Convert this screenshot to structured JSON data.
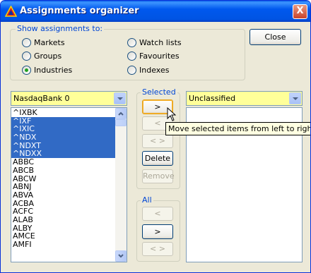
{
  "window": {
    "title": "Assignments organizer",
    "close_glyph": "X",
    "icon": "red-triangle-icon"
  },
  "show_group": {
    "legend": "Show assignments to:",
    "options": [
      {
        "label": "Markets",
        "selected": false
      },
      {
        "label": "Groups",
        "selected": false
      },
      {
        "label": "Industries",
        "selected": true
      },
      {
        "label": "Watch lists",
        "selected": false
      },
      {
        "label": "Favourites",
        "selected": false
      },
      {
        "label": "Indexes",
        "selected": false
      }
    ]
  },
  "close_button": "Close",
  "left_combo": "NasdaqBank 0",
  "right_combo": "Unclassified",
  "left_list": [
    {
      "text": "^IXBK",
      "selected": false
    },
    {
      "text": "^IXF",
      "selected": true
    },
    {
      "text": "^IXIC",
      "selected": true
    },
    {
      "text": "^NDX",
      "selected": true
    },
    {
      "text": "^NDXT",
      "selected": true
    },
    {
      "text": "^NDXX",
      "selected": true
    },
    {
      "text": "ABBC",
      "selected": false
    },
    {
      "text": "ABCB",
      "selected": false
    },
    {
      "text": "ABCW",
      "selected": false
    },
    {
      "text": "ABNJ",
      "selected": false
    },
    {
      "text": "ABVA",
      "selected": false
    },
    {
      "text": "ACBA",
      "selected": false
    },
    {
      "text": "ACFC",
      "selected": false
    },
    {
      "text": "ALAB",
      "selected": false
    },
    {
      "text": "ALBY",
      "selected": false
    },
    {
      "text": "AMCE",
      "selected": false
    },
    {
      "text": "AMFI",
      "selected": false
    }
  ],
  "selected_group": {
    "legend": "Selected",
    "move_right": ">",
    "move_left": "<",
    "swap": "< >",
    "delete": "Delete",
    "remove": "Remove"
  },
  "all_group": {
    "legend": "All",
    "move_left": "<",
    "move_right": ">",
    "swap": "< >"
  },
  "tooltip": "Move selected items from left to right",
  "colors": {
    "selection": "#316ac5",
    "combo_bg": "#ffff99",
    "titlebar": "#0054e3"
  }
}
